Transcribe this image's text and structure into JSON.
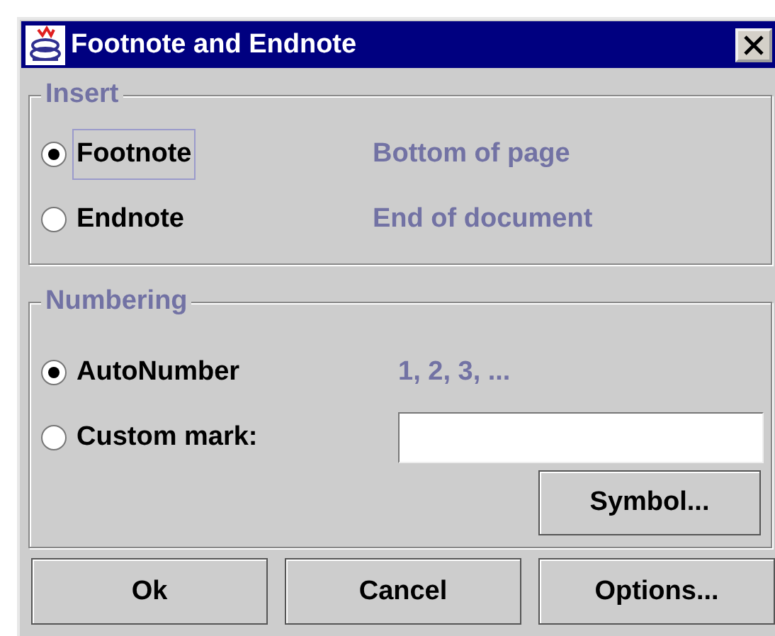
{
  "window": {
    "title": "Footnote and Endnote"
  },
  "insert": {
    "legend": "Insert",
    "options": [
      {
        "label": "Footnote",
        "description": "Bottom of page",
        "selected": true,
        "focused": true
      },
      {
        "label": "Endnote",
        "description": "End of document",
        "selected": false,
        "focused": false
      }
    ]
  },
  "numbering": {
    "legend": "Numbering",
    "options": [
      {
        "kind": "auto",
        "label": "AutoNumber",
        "description": "1, 2, 3, ...",
        "selected": true
      },
      {
        "kind": "custom",
        "label": "Custom mark:",
        "selected": false
      }
    ],
    "symbol_button": "Symbol..."
  },
  "buttons": [
    "Ok",
    "Cancel",
    "Options..."
  ]
}
